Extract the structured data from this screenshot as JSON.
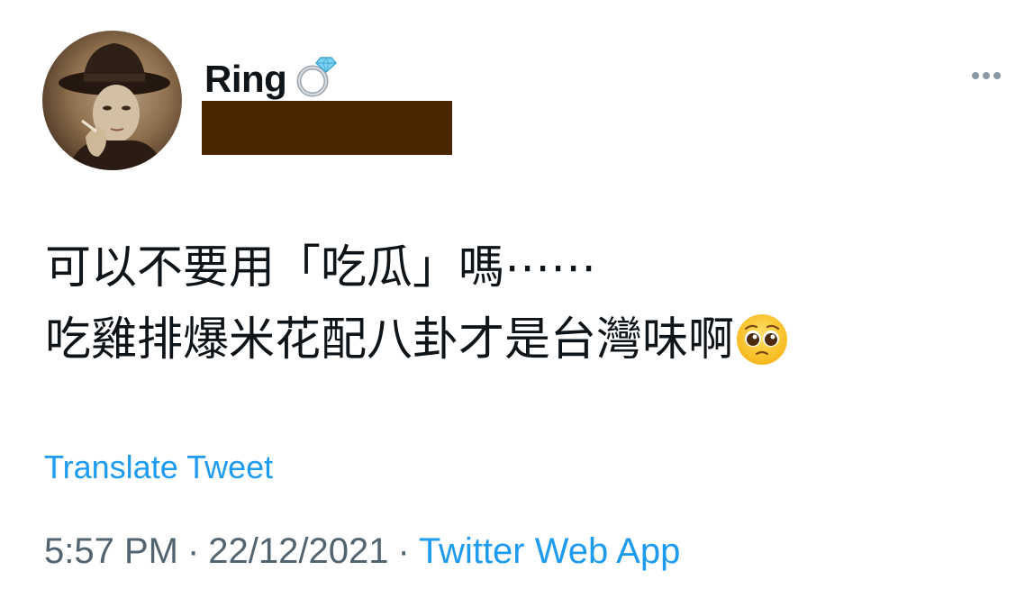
{
  "tweet": {
    "author": {
      "display_name": "Ring",
      "name_emoji": "ring-emoji"
    },
    "text_lines": [
      "可以不要用「吃瓜」嗎⋯⋯",
      "吃雞排爆米花配八卦才是台灣味啊"
    ],
    "text_emoji": "pleading-face-emoji",
    "translate_label": "Translate Tweet",
    "time": "5:57 PM",
    "date": "22/12/2021",
    "separator": "·",
    "source": "Twitter Web App"
  },
  "colors": {
    "link": "#1d9bf0",
    "meta": "#536471",
    "text": "#0f1419",
    "redaction": "#4a2600"
  },
  "icons": {
    "more": "more-horizontal-icon"
  }
}
